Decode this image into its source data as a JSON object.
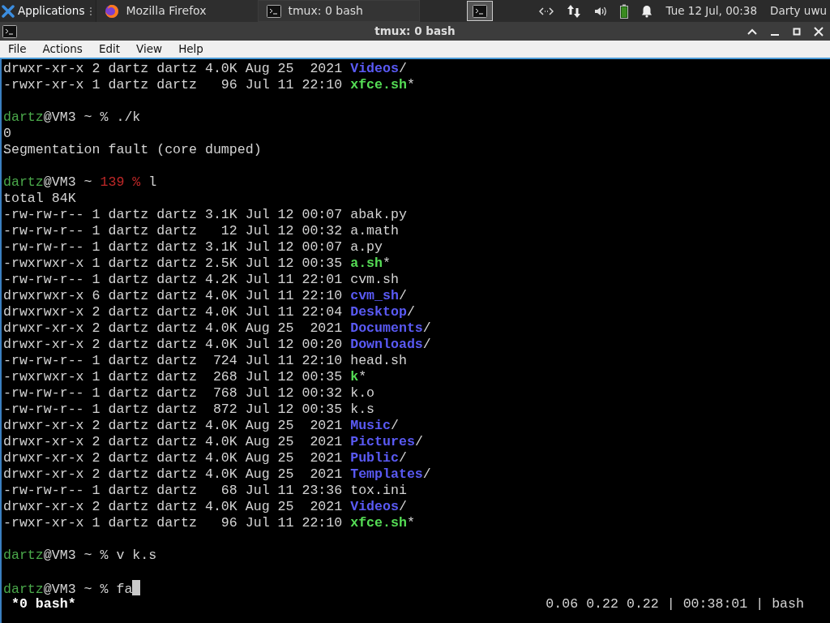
{
  "taskbar": {
    "menu": "Applications",
    "tasks": [
      {
        "label": "Mozilla Firefox",
        "kind": "firefox",
        "selected": false
      },
      {
        "label": "tmux: 0 bash",
        "kind": "terminal",
        "selected": true
      }
    ],
    "clock": "Tue 12 Jul, 00:38",
    "user": "Darty uwu"
  },
  "window": {
    "title": "tmux: 0 bash"
  },
  "menu": [
    "File",
    "Actions",
    "Edit",
    "View",
    "Help"
  ],
  "terminal": {
    "cursor": true,
    "lines": [
      {
        "kind": "text",
        "spans": [
          {
            "kind": "plain",
            "text": "drwxr-xr-x 2 dartz dartz 4.0K Aug 25  2021 "
          },
          {
            "kind": "dir",
            "text": "Videos"
          },
          {
            "kind": "plain",
            "text": "/"
          }
        ]
      },
      {
        "kind": "text",
        "spans": [
          {
            "kind": "plain",
            "text": "-rwxr-xr-x 1 dartz dartz   96 Jul 11 22:10 "
          },
          {
            "kind": "exec",
            "text": "xfce.sh"
          },
          {
            "kind": "plain",
            "text": "*"
          }
        ]
      },
      {
        "kind": "blank"
      },
      {
        "kind": "text",
        "spans": [
          {
            "kind": "user",
            "text": "dartz"
          },
          {
            "kind": "plain",
            "text": "@VM3 ~ % ./k"
          }
        ]
      },
      {
        "kind": "text",
        "spans": [
          {
            "kind": "plain",
            "text": "0"
          }
        ]
      },
      {
        "kind": "text",
        "spans": [
          {
            "kind": "plain",
            "text": "Segmentation fault (core dumped)"
          }
        ]
      },
      {
        "kind": "blank"
      },
      {
        "kind": "text",
        "spans": [
          {
            "kind": "user",
            "text": "dartz"
          },
          {
            "kind": "plain",
            "text": "@VM3 ~ "
          },
          {
            "kind": "error",
            "text": "139 %"
          },
          {
            "kind": "plain",
            "text": " l"
          }
        ]
      },
      {
        "kind": "text",
        "spans": [
          {
            "kind": "plain",
            "text": "total 84K"
          }
        ]
      },
      {
        "kind": "text",
        "spans": [
          {
            "kind": "plain",
            "text": "-rw-rw-r-- 1 dartz dartz 3.1K Jul 12 00:07 abak.py"
          }
        ]
      },
      {
        "kind": "text",
        "spans": [
          {
            "kind": "plain",
            "text": "-rw-rw-r-- 1 dartz dartz   12 Jul 12 00:32 a.math"
          }
        ]
      },
      {
        "kind": "text",
        "spans": [
          {
            "kind": "plain",
            "text": "-rw-rw-r-- 1 dartz dartz 3.1K Jul 12 00:07 a.py"
          }
        ]
      },
      {
        "kind": "text",
        "spans": [
          {
            "kind": "plain",
            "text": "-rwxrwxr-x 1 dartz dartz 2.5K Jul 12 00:35 "
          },
          {
            "kind": "exec",
            "text": "a.sh"
          },
          {
            "kind": "plain",
            "text": "*"
          }
        ]
      },
      {
        "kind": "text",
        "spans": [
          {
            "kind": "plain",
            "text": "-rw-rw-r-- 1 dartz dartz 4.2K Jul 11 22:01 cvm.sh"
          }
        ]
      },
      {
        "kind": "text",
        "spans": [
          {
            "kind": "plain",
            "text": "drwxrwxr-x 6 dartz dartz 4.0K Jul 11 22:10 "
          },
          {
            "kind": "dir",
            "text": "cvm_sh"
          },
          {
            "kind": "plain",
            "text": "/"
          }
        ]
      },
      {
        "kind": "text",
        "spans": [
          {
            "kind": "plain",
            "text": "drwxrwxr-x 2 dartz dartz 4.0K Jul 11 22:04 "
          },
          {
            "kind": "dir",
            "text": "Desktop"
          },
          {
            "kind": "plain",
            "text": "/"
          }
        ]
      },
      {
        "kind": "text",
        "spans": [
          {
            "kind": "plain",
            "text": "drwxr-xr-x 2 dartz dartz 4.0K Aug 25  2021 "
          },
          {
            "kind": "dir",
            "text": "Documents"
          },
          {
            "kind": "plain",
            "text": "/"
          }
        ]
      },
      {
        "kind": "text",
        "spans": [
          {
            "kind": "plain",
            "text": "drwxr-xr-x 2 dartz dartz 4.0K Jul 12 00:20 "
          },
          {
            "kind": "dir",
            "text": "Downloads"
          },
          {
            "kind": "plain",
            "text": "/"
          }
        ]
      },
      {
        "kind": "text",
        "spans": [
          {
            "kind": "plain",
            "text": "-rw-rw-r-- 1 dartz dartz  724 Jul 11 22:10 head.sh"
          }
        ]
      },
      {
        "kind": "text",
        "spans": [
          {
            "kind": "plain",
            "text": "-rwxrwxr-x 1 dartz dartz  268 Jul 12 00:35 "
          },
          {
            "kind": "exec",
            "text": "k"
          },
          {
            "kind": "plain",
            "text": "*"
          }
        ]
      },
      {
        "kind": "text",
        "spans": [
          {
            "kind": "plain",
            "text": "-rw-rw-r-- 1 dartz dartz  768 Jul 12 00:32 k.o"
          }
        ]
      },
      {
        "kind": "text",
        "spans": [
          {
            "kind": "plain",
            "text": "-rw-rw-r-- 1 dartz dartz  872 Jul 12 00:35 k.s"
          }
        ]
      },
      {
        "kind": "text",
        "spans": [
          {
            "kind": "plain",
            "text": "drwxr-xr-x 2 dartz dartz 4.0K Aug 25  2021 "
          },
          {
            "kind": "dir",
            "text": "Music"
          },
          {
            "kind": "plain",
            "text": "/"
          }
        ]
      },
      {
        "kind": "text",
        "spans": [
          {
            "kind": "plain",
            "text": "drwxr-xr-x 2 dartz dartz 4.0K Aug 25  2021 "
          },
          {
            "kind": "dir",
            "text": "Pictures"
          },
          {
            "kind": "plain",
            "text": "/"
          }
        ]
      },
      {
        "kind": "text",
        "spans": [
          {
            "kind": "plain",
            "text": "drwxr-xr-x 2 dartz dartz 4.0K Aug 25  2021 "
          },
          {
            "kind": "dir",
            "text": "Public"
          },
          {
            "kind": "plain",
            "text": "/"
          }
        ]
      },
      {
        "kind": "text",
        "spans": [
          {
            "kind": "plain",
            "text": "drwxr-xr-x 2 dartz dartz 4.0K Aug 25  2021 "
          },
          {
            "kind": "dir",
            "text": "Templates"
          },
          {
            "kind": "plain",
            "text": "/"
          }
        ]
      },
      {
        "kind": "text",
        "spans": [
          {
            "kind": "plain",
            "text": "-rw-rw-r-- 1 dartz dartz   68 Jul 11 23:36 tox.ini"
          }
        ]
      },
      {
        "kind": "text",
        "spans": [
          {
            "kind": "plain",
            "text": "drwxr-xr-x 2 dartz dartz 4.0K Aug 25  2021 "
          },
          {
            "kind": "dir",
            "text": "Videos"
          },
          {
            "kind": "plain",
            "text": "/"
          }
        ]
      },
      {
        "kind": "text",
        "spans": [
          {
            "kind": "plain",
            "text": "-rwxr-xr-x 1 dartz dartz   96 Jul 11 22:10 "
          },
          {
            "kind": "exec",
            "text": "xfce.sh"
          },
          {
            "kind": "plain",
            "text": "*"
          }
        ]
      },
      {
        "kind": "blank"
      },
      {
        "kind": "text",
        "spans": [
          {
            "kind": "user",
            "text": "dartz"
          },
          {
            "kind": "plain",
            "text": "@VM3 ~ % v k.s"
          }
        ]
      },
      {
        "kind": "blank"
      },
      {
        "kind": "text",
        "spans": [
          {
            "kind": "user",
            "text": "dartz"
          },
          {
            "kind": "plain",
            "text": "@VM3 ~ % fa"
          }
        ]
      }
    ]
  },
  "tmux_status": {
    "window": "*0 bash*",
    "info": "0.06 0.22 0.22 | 00:38:01 | bash"
  }
}
